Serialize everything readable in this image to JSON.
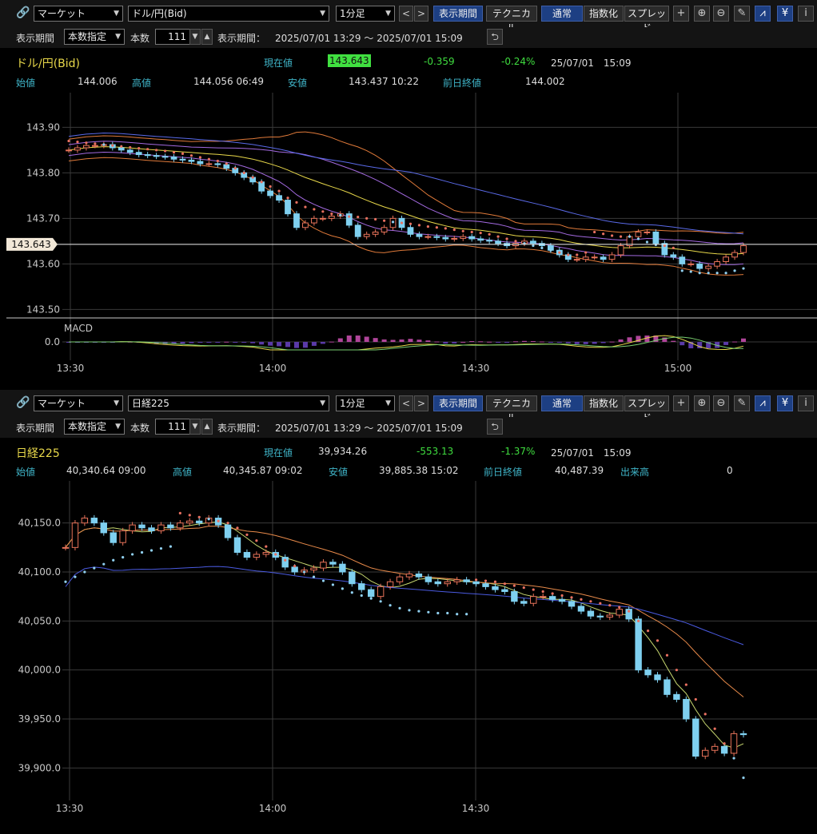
{
  "panels": [
    {
      "toolbar": {
        "market": "マーケット",
        "symbol": "ドル/円(Bid)",
        "interval": "1分足",
        "period_btn": "表示期間",
        "tech_btn": "テクニカル",
        "normal_btn": "通常",
        "index_btn": "指数化",
        "spread_btn": "スプレッド"
      },
      "row2": {
        "period_label": "表示期間",
        "period_mode": "本数指定",
        "count_label": "本数",
        "count_value": "111",
        "range_label": "表示期間：",
        "range_value": "2025/07/01 13:29 ～ 2025/07/01 15:09"
      },
      "info": {
        "name": "ドル/円(Bid)",
        "current_label": "現在値",
        "current_value": "143.643",
        "change": "-0.359",
        "change_pct": "-0.24%",
        "datetime": "25/07/01　15:09",
        "open_label": "始値",
        "open_value": "144.006",
        "high_label": "高値",
        "high_value": "144.056 06:49",
        "low_label": "安値",
        "low_value": "143.437 10:22",
        "prev_label": "前日終値",
        "prev_value": "144.002"
      }
    },
    {
      "toolbar": {
        "market": "マーケット",
        "symbol": "日経225",
        "interval": "1分足",
        "period_btn": "表示期間",
        "tech_btn": "テクニカル",
        "normal_btn": "通常",
        "index_btn": "指数化",
        "spread_btn": "スプレッド"
      },
      "row2": {
        "period_label": "表示期間",
        "period_mode": "本数指定",
        "count_label": "本数",
        "count_value": "111",
        "range_label": "表示期間：",
        "range_value": "2025/07/01 13:29 ～ 2025/07/01 15:09"
      },
      "info": {
        "name": "日経225",
        "current_label": "現在値",
        "current_value": "39,934.26",
        "change": "-553.13",
        "change_pct": "-1.37%",
        "datetime": "25/07/01　15:09",
        "open_label": "始値",
        "open_value": "40,340.64 09:00",
        "high_label": "高値",
        "high_value": "40,345.87 09:02",
        "low_label": "安値",
        "low_value": "39,885.38 15:02",
        "prev_label": "前日終値",
        "prev_value": "40,487.39",
        "volume_label": "出来高",
        "volume_value": "0"
      }
    }
  ],
  "colors": {
    "up": "#e8735a",
    "down": "#7fd0f0",
    "grid": "#3a3a3a",
    "text": "#c8c8c8",
    "cyan": "#3fb4c8",
    "highlight": "#40e040"
  },
  "chart_data": [
    {
      "type": "candlestick",
      "symbol": "ドル/円(Bid)",
      "x_ticks": [
        "13:30",
        "14:00",
        "14:30",
        "15:00"
      ],
      "y_ticks": [
        "143.90",
        "143.80",
        "143.70",
        "143.60",
        "143.50"
      ],
      "ylim": [
        143.455,
        143.955
      ],
      "current_price_label": "143.643",
      "indicators": [
        "bollinger",
        "sma",
        "parabolic_sar"
      ],
      "sub_chart": {
        "label": "MACD",
        "y_ticks": [
          "0.0"
        ]
      },
      "close": [
        143.85,
        143.855,
        143.86,
        143.86,
        143.862,
        143.855,
        143.85,
        143.845,
        143.84,
        143.838,
        143.836,
        143.835,
        143.83,
        143.828,
        143.825,
        143.82,
        143.82,
        143.818,
        143.81,
        143.8,
        143.79,
        143.78,
        143.76,
        143.75,
        143.74,
        143.71,
        143.68,
        143.69,
        143.7,
        143.7,
        143.705,
        143.71,
        143.685,
        143.66,
        143.665,
        143.67,
        143.68,
        143.7,
        143.68,
        143.665,
        143.66,
        143.66,
        143.658,
        143.655,
        143.656,
        143.66,
        143.655,
        143.652,
        143.65,
        143.645,
        143.64,
        143.645,
        143.65,
        143.645,
        143.64,
        143.63,
        143.62,
        143.61,
        143.61,
        143.615,
        143.615,
        143.61,
        143.62,
        143.64,
        143.66,
        143.67,
        143.67,
        143.645,
        143.62,
        143.615,
        143.6,
        143.6,
        143.59,
        143.595,
        143.605,
        143.615,
        143.625,
        143.64
      ],
      "sar": [
        143.87,
        143.868,
        143.866,
        143.864,
        143.862,
        143.86,
        143.858,
        143.856,
        143.854,
        143.852,
        143.85,
        143.848,
        143.845,
        143.842,
        143.838,
        143.834,
        143.83,
        143.826,
        143.82,
        143.81,
        143.8,
        143.79,
        143.78,
        143.77,
        143.76,
        143.745,
        143.735,
        143.725,
        143.72,
        143.715,
        143.71,
        143.707,
        143.704,
        143.703,
        143.7,
        143.698,
        143.695,
        143.692,
        143.69,
        143.688,
        143.685,
        143.682,
        143.68,
        143.678,
        143.675,
        143.672,
        143.67,
        143.668,
        143.665,
        143.66,
        143.655,
        143.65,
        143.645,
        143.64,
        143.635,
        143.63,
        143.625,
        143.62,
        143.62,
        143.625,
        143.67,
        143.666,
        143.662,
        143.66,
        143.66,
        143.655,
        143.648,
        143.642,
        143.64,
        143.635,
        143.585,
        143.583,
        143.58,
        143.58,
        143.58,
        143.58,
        143.585,
        143.59
      ]
    },
    {
      "type": "candlestick",
      "symbol": "日経225",
      "x_ticks": [
        "13:30",
        "14:00",
        "14:30"
      ],
      "y_ticks": [
        "40,150.0",
        "40,100.0",
        "40,050.0",
        "40,000.0",
        "39,950.0",
        "39,900.0"
      ],
      "ylim": [
        39875,
        40175
      ],
      "indicators": [
        "sma",
        "parabolic_sar"
      ],
      "close": [
        40125,
        40150,
        40155,
        40150,
        40140,
        40130,
        40142,
        40148,
        40145,
        40142,
        40148,
        40145,
        40150,
        40152,
        40150,
        40155,
        40148,
        40135,
        40120,
        40115,
        40118,
        40120,
        40115,
        40105,
        40100,
        40102,
        40104,
        40110,
        40108,
        40100,
        40088,
        40082,
        40075,
        40085,
        40090,
        40095,
        40098,
        40095,
        40090,
        40088,
        40090,
        40092,
        40090,
        40088,
        40085,
        40082,
        40080,
        40070,
        40068,
        40075,
        40075,
        40072,
        40070,
        40065,
        40060,
        40055,
        40054,
        40056,
        40062,
        40052,
        40000,
        39995,
        39990,
        39975,
        39970,
        39950,
        39912,
        39918,
        39922,
        39915,
        39935,
        39934
      ],
      "sar": [
        40090,
        40095,
        40100,
        40104,
        40108,
        40112,
        40115,
        40118,
        40120,
        40122,
        40124,
        40126,
        40160,
        40158,
        40156,
        40154,
        40152,
        40150,
        40145,
        40138,
        40132,
        40126,
        40118,
        40112,
        40106,
        40100,
        40095,
        40091,
        40087,
        40083,
        40079,
        40076,
        40073,
        40070,
        40066,
        40063,
        40061,
        40060,
        40059,
        40058,
        40058,
        40057,
        40057,
        40092,
        40091,
        40090,
        40088,
        40086,
        40084,
        40082,
        40080,
        40078,
        40076,
        40074,
        40072,
        40070,
        40068,
        40066,
        40064,
        40060,
        40050,
        40040,
        40030,
        40015,
        40000,
        39985,
        39970,
        39955,
        39940,
        39925,
        39910,
        39890
      ]
    }
  ]
}
